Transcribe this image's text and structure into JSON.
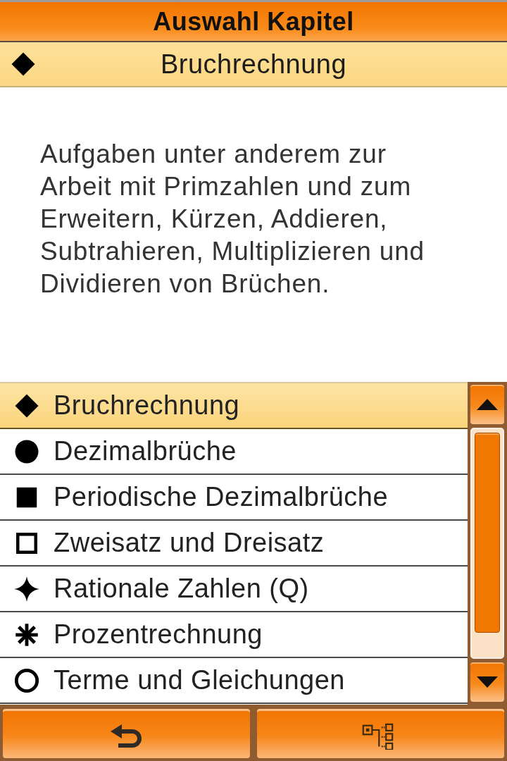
{
  "header": {
    "title": "Auswahl Kapitel"
  },
  "banner": {
    "kind": "diamond",
    "title": "Bruchrechnung"
  },
  "description": "Aufgaben unter anderem zur Arbeit mit Primzahlen und zum Erweitern, Kürzen, Addieren, Subtrahieren, Multiplizieren und Dividieren von Brüchen.",
  "chapters": [
    {
      "kind": "diamond",
      "label": "Bruchrechnung",
      "selected": true
    },
    {
      "kind": "circle",
      "label": "Dezimalbrüche",
      "selected": false
    },
    {
      "kind": "square",
      "label": "Periodische Dezimalbrüche",
      "selected": false
    },
    {
      "kind": "square-outline",
      "label": "Zweisatz und Dreisatz",
      "selected": false
    },
    {
      "kind": "star",
      "label": "Rationale Zahlen (Q)",
      "selected": false
    },
    {
      "kind": "asterisk",
      "label": "Prozentrechnung",
      "selected": false
    },
    {
      "kind": "circle-outline",
      "label": "Terme und Gleichungen",
      "selected": false
    }
  ]
}
